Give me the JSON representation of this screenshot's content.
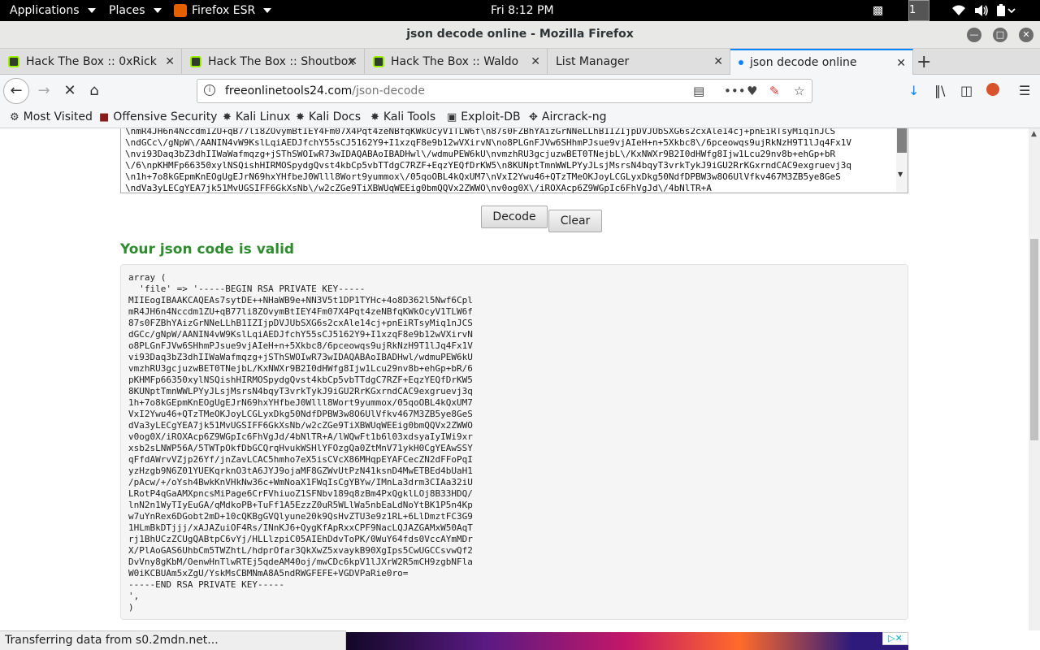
{
  "topbar": {
    "applications": "Applications",
    "places": "Places",
    "firefox": "Firefox ESR",
    "clock": "Fri  8:12 PM",
    "workspace": "1"
  },
  "window": {
    "title": "json decode online - Mozilla Firefox"
  },
  "tabs": [
    {
      "label": "Hack The Box :: 0xRick"
    },
    {
      "label": "Hack The Box :: Shoutbox"
    },
    {
      "label": "Hack The Box :: Waldo"
    },
    {
      "label": "List Manager"
    },
    {
      "label": "json decode online"
    }
  ],
  "navbar": {
    "url_host": "freeonlinetools24.com",
    "url_path": "/json-decode"
  },
  "bookmarks": [
    {
      "label": "Most Visited"
    },
    {
      "label": "Offensive Security"
    },
    {
      "label": "Kali Linux"
    },
    {
      "label": "Kali Docs"
    },
    {
      "label": "Kali Tools"
    },
    {
      "label": "Exploit-DB"
    },
    {
      "label": "Aircrack-ng"
    }
  ],
  "page": {
    "input_text": "\\nmR4JH6n4Nccdm1ZU+qB77li8ZOvymBtIEY4Fm07X4Pqt4zeNBfqKWkOcyV1TLW6f\\n87s0FZBhYAizGrNNeLLhB1IZIjpDVJUbSXG6s2cxAle14cj+pnEiRTsyMiq1nJCS\n\\ndGCc\\/gNpW\\/AANIN4vW9KslLqiAEDJfchY55sCJ5162Y9+I1xzqF8e9b12wVXirvN\\no8PLGnFJVw6SHhmPJsue9vjAIeH+n+5Xkbc8\\/6pceowqs9ujRkNzH9T1lJq4Fx1V\n\\nvi93Daq3bZ3dhIIWaWafmqzg+jSThSWOIwR73wIDAQABAoIBADHwl\\/wdmuPEW6kU\\nvmzhRU3gcjuzwBET0TNejbL\\/KxNWXr9B2I0dHWfg8Ijw1Lcu29nv8b+ehGp+bR\n\\/6\\npKHMFp66350xylNSQishHIRMOSpydgQvst4kbCp5vbTTdgC7RZF+EqzYEQfDrKW5\\n8KUNptTmnWWLPYyJLsjMsrsN4bqyT3vrkTykJ9iGU2RrKGxrndCAC9exgruevj3q\n\\n1h+7o8kGEpmKnEOgUgEJrN69hxYHfbeJ0Wlll8Wort9yummox\\/05qoOBL4kQxUM7\\nVxI2Ywu46+QTzTMeOKJoyLCGLyxDkg50NdfDPBW3w8O6UlVfkv467M3ZB5ye8GeS\n\\ndVa3yLECgYEA7jk51MvUGSIFF6GkXsNb\\/w2cZGe9TiXBWUqWEEig0bmQQVx2ZWWO\\nv0og0X\\/iROXAcp6Z9WGpIc6FhVgJd\\/4bNlTR+A",
    "decode_label": "Decode",
    "clear_label": "Clear",
    "valid_message": "Your json code is valid",
    "result_text": "array (\n  'file' => '-----BEGIN RSA PRIVATE KEY-----\nMIIEogIBAAKCAQEAs7sytDE++NHaWB9e+NN3V5t1DP1TYHc+4o8D362l5Nwf6Cpl\nmR4JH6n4Nccdm1ZU+qB77li8ZOvymBtIEY4Fm07X4Pqt4zeNBfqKWkOcyV1TLW6f\n87s0FZBhYAizGrNNeLLhB1IZIjpDVJUbSXG6s2cxAle14cj+pnEiRTsyMiq1nJCS\ndGCc/gNpW/AANIN4vW9KslLqiAEDJfchY55sCJ5162Y9+I1xzqF8e9b12wVXirvN\no8PLGnFJVw6SHhmPJsue9vjAIeH+n+5Xkbc8/6pceowqs9ujRkNzH9T1lJq4Fx1V\nvi93Daq3bZ3dhIIWaWafmqzg+jSThSWOIwR73wIDAQABAoIBADHwl/wdmuPEW6kU\nvmzhRU3gcjuzwBET0TNejbL/KxNWXr9B2I0dHWfg8Ijw1Lcu29nv8b+ehGp+bR/6\npKHMFp66350xylNSQishHIRMOSpydgQvst4kbCp5vbTTdgC7RZF+EqzYEQfDrKW5\n8KUNptTmnWWLPYyJLsjMsrsN4bqyT3vrkTykJ9iGU2RrKGxrndCAC9exgruevj3q\n1h+7o8kGEpmKnEOgUgEJrN69hxYHfbeJ0Wlll8Wort9yummox/05qoOBL4kQxUM7\nVxI2Ywu46+QTzTMeOKJoyLCGLyxDkg50NdfDPBW3w8O6UlVfkv467M3ZB5ye8GeS\ndVa3yLECgYEA7jk51MvUGSIFF6GkXsNb/w2cZGe9TiXBWUqWEEig0bmQQVx2ZWWO\nv0og0X/iROXAcp6Z9WGpIc6FhVgJd/4bNlTR+A/lWQwFt1b6l03xdsyaIyIWi9xr\nxsb2sLNWP56A/5TWTpOkfDbGCQrqHvukWSHlYFOzgQa0ZtMnV71ykH0CgYEAwSSY\nqFfdAWrvVZjp26Yf/jnZavLCAC5hmho7eX5isCVcX86MHqpEYAFCecZN2dFFoPqI\nyzHzgb9N6Z01YUEKqrknO3tA6JYJ9ojaMF8GZWvUtPzN41ksnD4MwETBEd4bUaH1\n/pAcw/+/oYsh4BwkKnVHkNw36c+WmNoaX1FWqIsCgYBYw/IMnLa3drm3CIAa32iU\nLRotP4qGaAMXpncsMiPage6CrFVhiuoZ1SFNbv189q8zBm4PxQgklLOj8B33HDQ/\nlnN2n1WyTIyEuGA/qMdkoPB+TuFf1A5EzzZ0uR5WLlWa5nbEaLdNoYtBK1P5n4Kp\nw7uYnRex6DGobt2mD+10cQKBgGVQlyune20k9QsHvZTU3e9z1RL+6LlDmztFC3G9\n1HLmBkDTjjj/xAJAZuiOF4Rs/INnKJ6+QygKfApRxxCPF9NacLQJAZGAMxW50AqT\nrj1BhUCzZCUgQABtpC6vYj/HLLlzpiC05AIEhDdvToPK/0WuY64fds0VccAYmMDr\nX/PlAoGAS6UhbCm5TWZhtL/hdprOfar3QkXwZ5xvaykB90XgIps5CwUGCCsvwQf2\nDvVny8gKbM/OenwHnTlwRTEj5qdeAM40oj/mwCDc6kpV1lJXrW2R5mCH9zgbNFla\nW0iKCBUAm5xZgU/YskMsCBMNmA8A5ndRWGFEFE+VGDVPaRie0ro=\n-----END RSA PRIVATE KEY-----\n',\n)"
  },
  "status": {
    "text": "Transferring data from s0.2mdn.net..."
  },
  "colors": {
    "valid_green": "#2e8b2e",
    "tab_accent": "#0a84ff"
  }
}
